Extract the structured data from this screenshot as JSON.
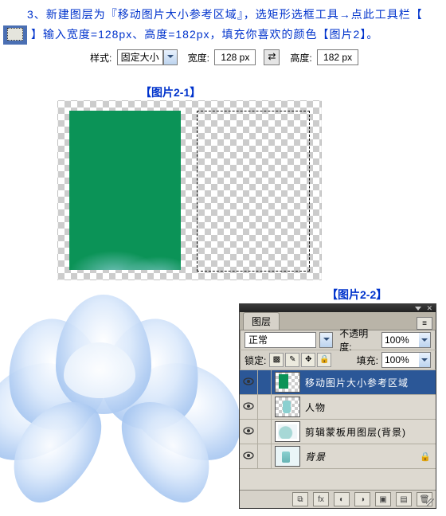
{
  "instruction": {
    "prefix": "　　3、新建图层为『移动图片大小参考区域』，选矩形选框工具→点此工具栏【",
    "middle": "】输入宽度=128px、高度=182px，填充你喜欢的颜色【图片2】。"
  },
  "toolbar": {
    "style_label": "样式:",
    "style_value": "固定大小",
    "width_label": "宽度:",
    "width_value": "128 px",
    "swap_glyph": "⇄",
    "height_label": "高度:",
    "height_value": "182 px"
  },
  "captions": {
    "c21": "【图片2-1】",
    "c22": "【图片2-2】"
  },
  "panel": {
    "tab": "图层",
    "menu_glyph": "≡",
    "blend_mode": "正常",
    "opacity_label": "不透明度:",
    "opacity_value": "100%",
    "lock_label": "锁定:",
    "fill_label": "填充:",
    "fill_value": "100%",
    "lock_icons": {
      "transparent": "▩",
      "image": "✎",
      "position": "✥",
      "all": "🔒"
    },
    "layers": [
      {
        "name": "移动图片大小参考区域",
        "visible": true,
        "thumb": "green",
        "selected": true
      },
      {
        "name": "人物",
        "visible": true,
        "thumb": "person",
        "selected": false
      },
      {
        "name": "剪辑蒙板用图层(背景)",
        "visible": true,
        "thumb": "clip",
        "selected": false
      },
      {
        "name": "背景",
        "visible": true,
        "thumb": "bg",
        "selected": false,
        "locked": true,
        "italic": true
      }
    ],
    "footer": {
      "link": "⧉",
      "fx": "fx",
      "mask": "◐",
      "adjust": "◑",
      "folder": "▣",
      "new": "▤",
      "trash": "🗑"
    }
  }
}
